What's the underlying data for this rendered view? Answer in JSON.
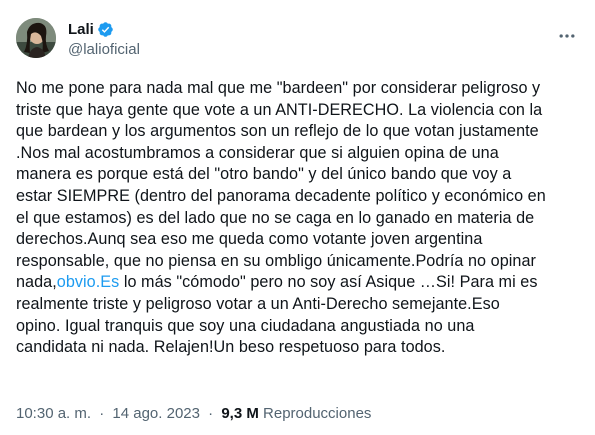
{
  "author": {
    "display_name": "Lali",
    "handle": "@lalioficial",
    "verified": true,
    "avatar_icon": "avatar-photo"
  },
  "menu": {
    "icon": "more-horizontal-icon"
  },
  "tweet": {
    "lines": [
      "No me pone para nada mal que me \"bardeen\" por considerar peligroso y",
      "triste que haya gente que vote a un ANTI-DERECHO. La violencia con la",
      "que bardean y los argumentos son un reflejo de lo que votan justamente",
      ".Nos mal acostumbramos a considerar que si alguien opina de una",
      "manera es porque está del \"otro bando\" y del único bando que voy a",
      "estar SIEMPRE (dentro del panorama decadente político y económico en",
      "el que estamos) es del lado que no se caga en lo ganado en materia de",
      "derechos.Aunq sea eso me queda como votante joven argentina",
      "responsable, que no piensa en su ombligo únicamente.Podría no opinar",
      {
        "before": "nada,",
        "link": "obvio.Es",
        "after": " lo más \"cómodo\" pero no soy así Asique …Si! Para mi es"
      },
      "realmente triste y peligroso votar a un Anti-Derecho semejante.Eso",
      "opino. Igual tranquis que soy una ciudadana angustiada no una",
      "candidata ni nada. Relajen!Un beso respetuoso para todos."
    ]
  },
  "meta": {
    "time": "10:30 a. m.",
    "separator": "·",
    "date": "14 ago. 2023",
    "views_count": "9,3 M",
    "views_label": "Reproducciones"
  },
  "colors": {
    "text": "#0f1419",
    "secondary": "#536471",
    "link": "#1d9bf0",
    "verified": "#1d9bf0"
  }
}
